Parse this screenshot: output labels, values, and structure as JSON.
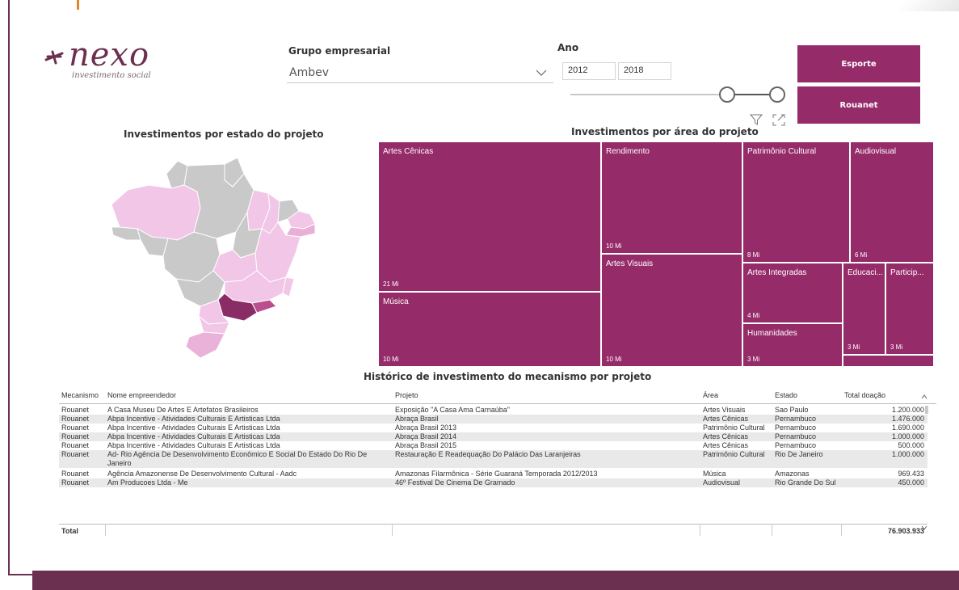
{
  "logo": {
    "name": "nexo",
    "tagline": "investimento social"
  },
  "filters": {
    "group_label": "Grupo empresarial",
    "group_value": "Ambev",
    "year_label": "Ano",
    "year_from": "2012",
    "year_to": "2018"
  },
  "buttons": {
    "esporte": "Esporte",
    "rouanet": "Rouanet"
  },
  "map": {
    "title": "Investimentos por estado do projeto"
  },
  "treemap": {
    "title": "Investimentos por área do projeto",
    "tiles": [
      {
        "name": "Artes Cênicas",
        "value": "21 Mi"
      },
      {
        "name": "Rendimento",
        "value": "10 Mi"
      },
      {
        "name": "Patrimônio Cultural",
        "value": "8 Mi"
      },
      {
        "name": "Audiovisual",
        "value": "6 Mi"
      },
      {
        "name": "Música",
        "value": "10 Mi"
      },
      {
        "name": "Artes Visuais",
        "value": "10 Mi"
      },
      {
        "name": "Artes Integradas",
        "value": "4 Mi"
      },
      {
        "name": "Educaci...",
        "value": "3 Mi"
      },
      {
        "name": "Particip...",
        "value": "3 Mi"
      },
      {
        "name": "Humanidades",
        "value": "3 Mi"
      }
    ]
  },
  "table": {
    "title": "Histórico de investimento do mecanismo por projeto",
    "headers": [
      "Mecanismo",
      "Nome empreendedor",
      "Projeto",
      "Área",
      "Estado",
      "Total doação"
    ],
    "rows": [
      [
        "Rouanet",
        "A Casa Museu De Artes E Artefatos Brasileiros",
        "Exposição \"A Casa Ama Carnaúba\"",
        "Artes Visuais",
        "Sao Paulo",
        "1.200.000"
      ],
      [
        "Rouanet",
        "Abpa Incentive - Atividades Culturais E Artisticas Ltda",
        "Abraça Brasil",
        "Artes Cênicas",
        "Pernambuco",
        "1.476.000"
      ],
      [
        "Rouanet",
        "Abpa Incentive - Atividades Culturais E Artisticas Ltda",
        "Abraça Brasil 2013",
        "Patrimônio Cultural",
        "Pernambuco",
        "1.690.000"
      ],
      [
        "Rouanet",
        "Abpa Incentive - Atividades Culturais E Artisticas Ltda",
        "Abraça Brasil 2014",
        "Artes Cênicas",
        "Pernambuco",
        "1.000.000"
      ],
      [
        "Rouanet",
        "Abpa Incentive - Atividades Culturais E Artisticas Ltda",
        "Abraça Brasil 2015",
        "Artes Cênicas",
        "Pernambuco",
        "500.000"
      ],
      [
        "Rouanet",
        "Ad- Rio Agência De Desenvolvimento Econômico E Social Do Estado Do Rio De",
        "Restauração E Readequação Do Palácio Das Laranjeiras",
        "Patrimônio Cultural",
        "Rio De Janeiro",
        "1.000.000"
      ],
      [
        "",
        "Janeiro",
        "",
        "",
        "",
        ""
      ],
      [
        "Rouanet",
        "Agência Amazonense De Desenvolvimento Cultural - Aadc",
        "Amazonas Filarmônica - Série Guaraná Temporada 2012/2013",
        "Música",
        "Amazonas",
        "969.433"
      ],
      [
        "Rouanet",
        "Am Producoes Ltda - Me",
        "46º Festival De Cinema De Gramado",
        "Audiovisual",
        "Rio Grande Do Sul",
        "450.000"
      ]
    ],
    "total_label": "Total",
    "total_value": "76.903.933"
  },
  "colors": {
    "primary": "#952b69",
    "frame": "#6b2f4f",
    "accent": "#e8832a"
  }
}
